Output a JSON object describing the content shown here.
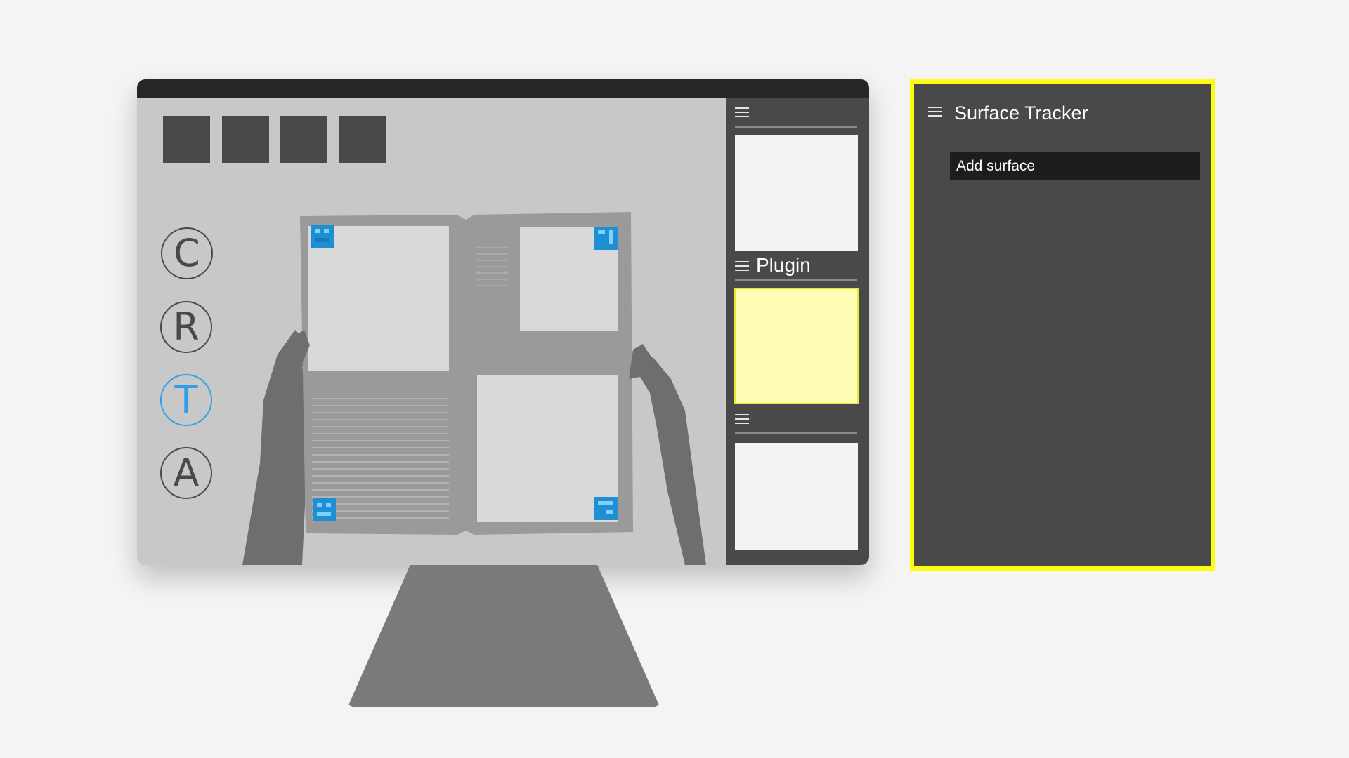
{
  "modes": [
    {
      "label": "C",
      "active": false
    },
    {
      "label": "R",
      "active": false
    },
    {
      "label": "T",
      "active": true
    },
    {
      "label": "A",
      "active": false
    }
  ],
  "side_panel": {
    "section_title": "Plugin"
  },
  "surface_tracker": {
    "title": "Surface Tracker",
    "add_button_label": "Add surface"
  },
  "colors": {
    "highlight": "#ffff12",
    "active_mode": "#2f9fe6",
    "marker": "#1f8fd4",
    "panel": "#4a494a"
  },
  "icons": {
    "menu": "menu-icon",
    "marker": "surface-marker-icon"
  }
}
